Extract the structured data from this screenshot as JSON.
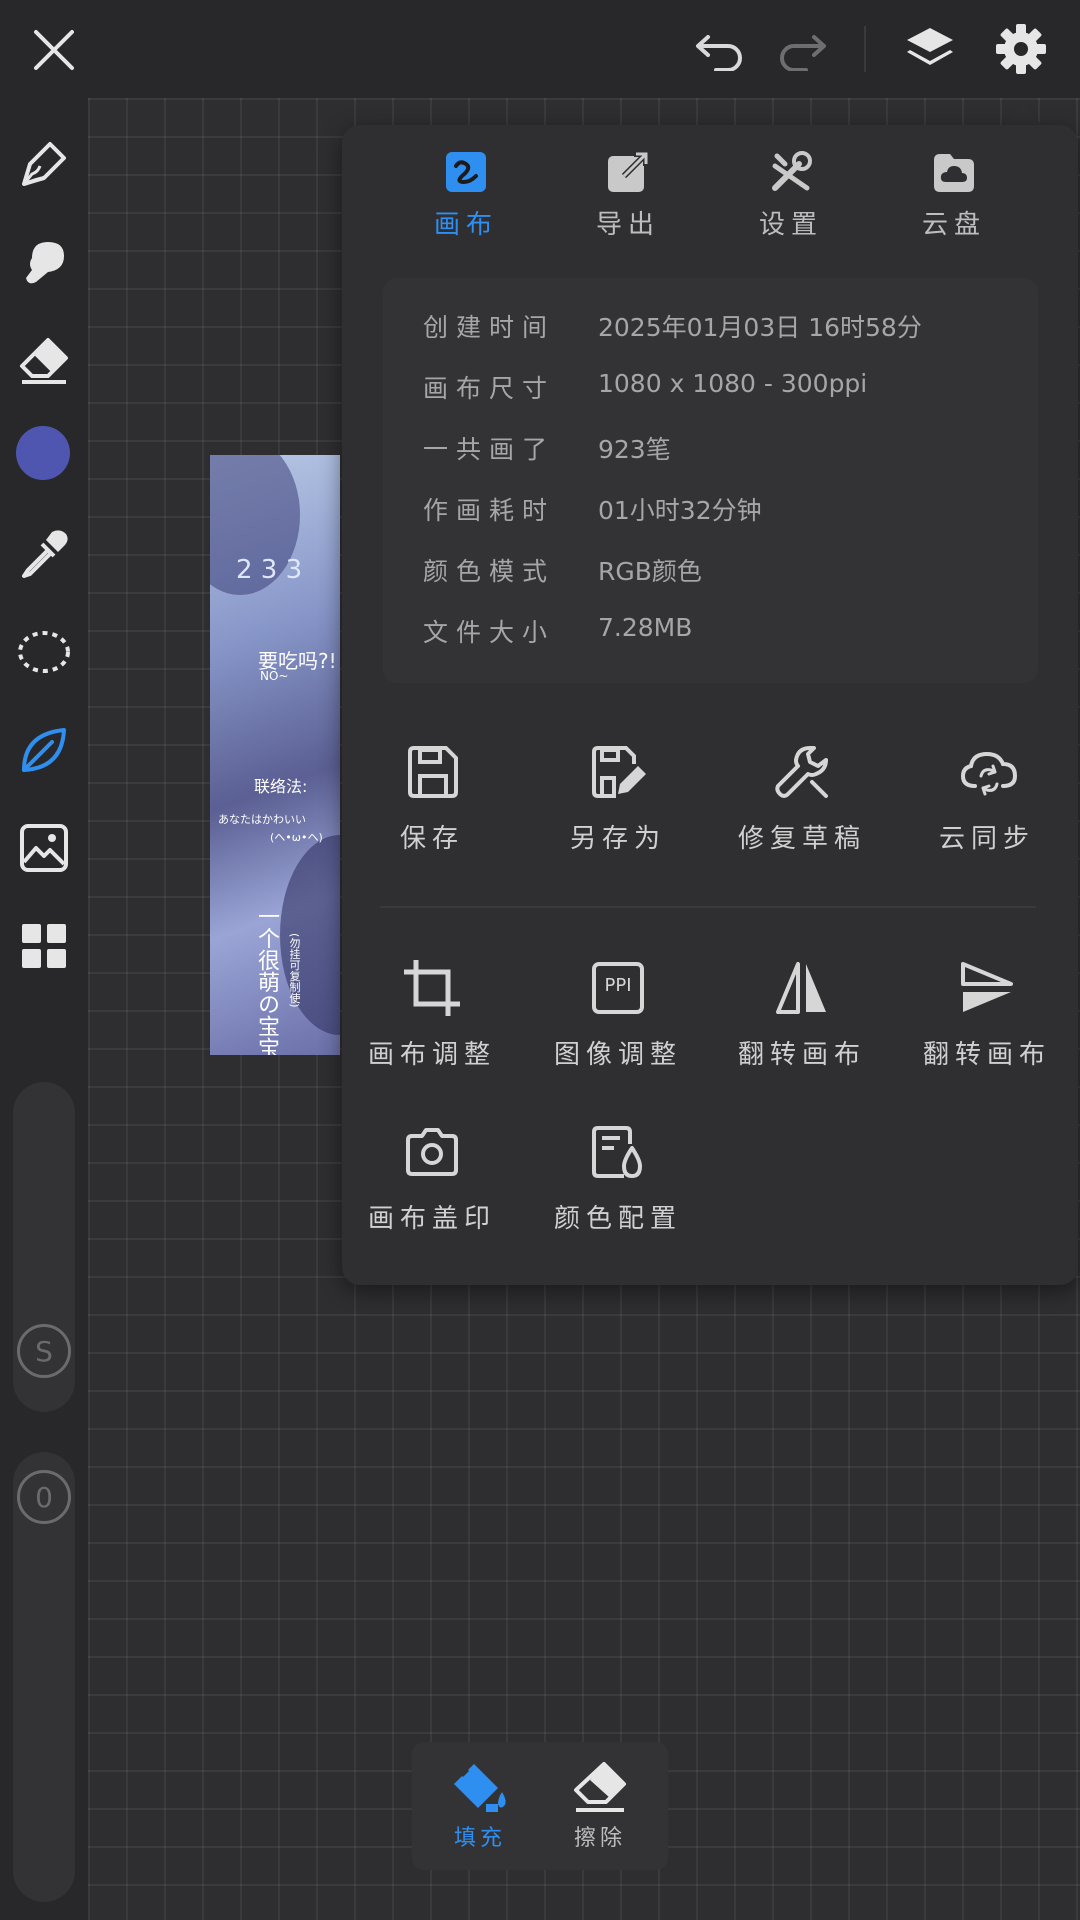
{
  "theme": {
    "accent": "#2f8ff0",
    "color_swatch": "#4f56b0"
  },
  "topbar": {
    "close_icon": "close-icon",
    "undo_icon": "undo-icon",
    "redo_icon": "redo-icon",
    "layers_icon": "layers-icon",
    "settings_icon": "gear-icon"
  },
  "sidebar": {
    "tools": [
      "pen-tool",
      "smudge-tool",
      "eraser-tool",
      "color-swatch",
      "eyedropper-tool",
      "lasso-tool",
      "leaf-brush-tool",
      "image-import-tool",
      "grid-tool"
    ],
    "size_slider_label": "S",
    "opacity_slider_label": "0"
  },
  "artwork": {
    "texts": [
      "2 3 3",
      "要吃吗?!",
      "NO~",
      "联络法:",
      "あなたはかわいい",
      "(ヘ•ω•ヘ)",
      "一个很萌の宝宝",
      "(勿挂可复制使)"
    ]
  },
  "panel": {
    "tabs": [
      {
        "label": "画布",
        "icon": "canvas-icon",
        "active": true
      },
      {
        "label": "导出",
        "icon": "export-icon",
        "active": false
      },
      {
        "label": "设置",
        "icon": "settings-tools-icon",
        "active": false
      },
      {
        "label": "云盘",
        "icon": "cloud-drive-icon",
        "active": false
      }
    ],
    "info": [
      {
        "key": "创建时间",
        "value": "2025年01月03日 16时58分"
      },
      {
        "key": "画布尺寸",
        "value": "1080 x 1080 - 300ppi"
      },
      {
        "key": "一共画了",
        "value": "923笔"
      },
      {
        "key": "作画耗时",
        "value": "01小时32分钟"
      },
      {
        "key": "颜色模式",
        "value": "RGB颜色"
      },
      {
        "key": "文件大小",
        "value": "7.28MB"
      }
    ],
    "actions_row1": [
      {
        "label": "保存",
        "icon": "save-icon"
      },
      {
        "label": "另存为",
        "icon": "save-as-icon"
      },
      {
        "label": "修复草稿",
        "icon": "repair-icon"
      },
      {
        "label": "云同步",
        "icon": "cloud-sync-icon"
      }
    ],
    "actions_row2": [
      {
        "label": "画布调整",
        "icon": "crop-icon"
      },
      {
        "label": "图像调整",
        "icon": "ppi-icon",
        "icon_text": "PPI"
      },
      {
        "label": "翻转画布",
        "icon": "flip-horizontal-icon"
      },
      {
        "label": "翻转画布",
        "icon": "flip-vertical-icon"
      }
    ],
    "actions_row3": [
      {
        "label": "画布盖印",
        "icon": "camera-icon"
      },
      {
        "label": "颜色配置",
        "icon": "color-config-icon"
      }
    ]
  },
  "bottom_tools": [
    {
      "label": "填充",
      "icon": "fill-bucket-icon",
      "active": true
    },
    {
      "label": "擦除",
      "icon": "eraser-icon",
      "active": false
    }
  ]
}
